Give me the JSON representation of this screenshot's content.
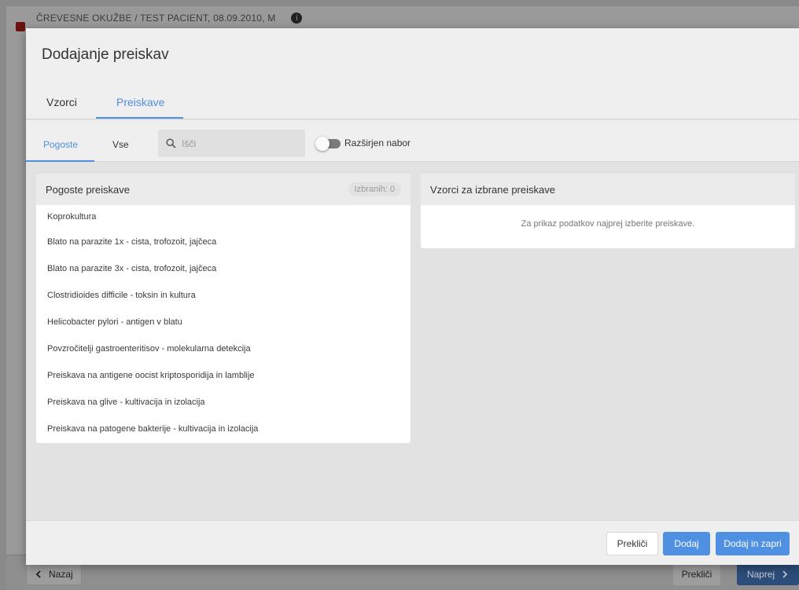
{
  "background": {
    "breadcrumb": "ČREVESNE OKUŽBE  /  TEST PACIENT, 08.09.2010, M",
    "back_label": "Nazaj",
    "cancel_label": "Prekliči",
    "next_label": "Naprej"
  },
  "modal": {
    "title": "Dodajanje preiskav",
    "tabs": [
      {
        "label": "Vzorci"
      },
      {
        "label": "Preiskave"
      }
    ],
    "subtabs": [
      {
        "label": "Pogoste"
      },
      {
        "label": "Vse"
      }
    ],
    "search": {
      "placeholder": "Išči",
      "value": ""
    },
    "toggle_label": "Razširjen nabor",
    "left_panel": {
      "title": "Pogoste preiskave",
      "count": "Izbranih: 0",
      "items": [
        "Koprokultura",
        "Blato na parazite 1x - cista, trofozoit, jajčeca",
        "Blato na parazite 3x - cista, trofozoit, jajčeca",
        "Clostridioides difficile - toksin in kultura",
        "Helicobacter pylori - antigen v blatu",
        "Povzročitelji gastroenteritisov - molekularna detekcija",
        "Preiskava na antigene oocist kriptosporidija in lamblije",
        "Preiskava na glive - kultivacija in izolacija",
        "Preiskava na patogene bakterije - kultivacija in izolacija"
      ]
    },
    "right_panel": {
      "title": "Vzorci za izbrane preiskave",
      "empty_message": "Za prikaz podatkov najprej izberite preiskave."
    },
    "footer": {
      "cancel_label": "Prekliči",
      "add_label": "Dodaj",
      "add_close_label": "Dodaj in zapri"
    }
  },
  "colors": {
    "accent": "#4f90e2",
    "tab_active": "#4f8fde"
  }
}
